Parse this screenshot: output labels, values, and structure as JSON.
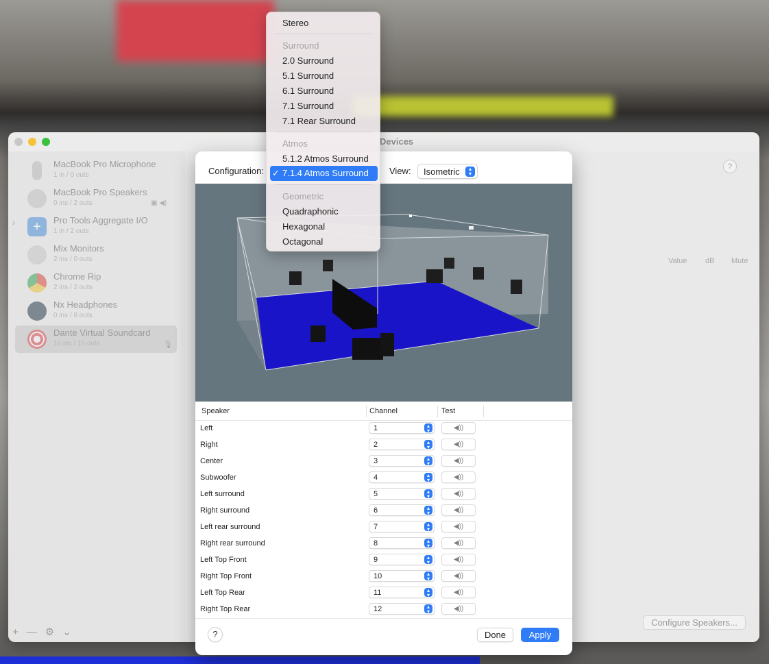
{
  "window": {
    "title": "Devices"
  },
  "sidebar": {
    "devices": [
      {
        "name": "MacBook Pro Microphone",
        "sub": "1 in / 0 outs",
        "icon": "microphone-icon"
      },
      {
        "name": "MacBook Pro Speakers",
        "sub": "0 ins / 2 outs",
        "icon": "speaker-icon"
      },
      {
        "name": "Pro Tools Aggregate I/O",
        "sub": "1 in / 2 outs",
        "icon": "aggregate-device-icon"
      },
      {
        "name": "Mix Monitors",
        "sub": "2 ins / 0 outs",
        "icon": "microphone-icon"
      },
      {
        "name": "Chrome Rip",
        "sub": "2 ins / 2 outs",
        "icon": "chrome-icon"
      },
      {
        "name": "Nx Headphones",
        "sub": "0 ins / 8 outs",
        "icon": "waves-icon"
      },
      {
        "name": "Dante Virtual Soundcard",
        "sub": "16 ins / 16 outs",
        "icon": "dante-icon"
      }
    ],
    "footer": {
      "add": "+",
      "remove": "—",
      "gear": "⚙",
      "chevron": "⌄"
    }
  },
  "main": {
    "columns": {
      "value": "Value",
      "db": "dB",
      "mute": "Mute"
    },
    "configure_button": "Configure Speakers..."
  },
  "sheet": {
    "config_label": "Configuration:",
    "view_label": "View:",
    "view_value": "Isometric",
    "table": {
      "headers": {
        "speaker": "Speaker",
        "channel": "Channel",
        "test": "Test"
      },
      "rows": [
        {
          "speaker": "Left",
          "channel": "1"
        },
        {
          "speaker": "Right",
          "channel": "2"
        },
        {
          "speaker": "Center",
          "channel": "3"
        },
        {
          "speaker": "Subwoofer",
          "channel": "4"
        },
        {
          "speaker": "Left surround",
          "channel": "5"
        },
        {
          "speaker": "Right surround",
          "channel": "6"
        },
        {
          "speaker": "Left rear surround",
          "channel": "7"
        },
        {
          "speaker": "Right rear surround",
          "channel": "8"
        },
        {
          "speaker": "Left Top Front",
          "channel": "9"
        },
        {
          "speaker": "Right Top Front",
          "channel": "10"
        },
        {
          "speaker": "Left Top Rear",
          "channel": "11"
        },
        {
          "speaker": "Right Top Rear",
          "channel": "12"
        }
      ],
      "test_glyph": "◀))"
    },
    "help": "?",
    "done": "Done",
    "apply": "Apply"
  },
  "menu": {
    "stereo": "Stereo",
    "surround_header": "Surround",
    "surround": [
      "2.0 Surround",
      "5.1 Surround",
      "6.1 Surround",
      "7.1 Surround",
      "7.1 Rear Surround"
    ],
    "atmos_header": "Atmos",
    "atmos_512": "5.1.2 Atmos Surround",
    "atmos_714": "7.1.4 Atmos Surround",
    "check": "✓",
    "geometric_header": "Geometric",
    "geometric": [
      "Quadraphonic",
      "Hexagonal",
      "Octagonal"
    ]
  },
  "colors": {
    "accent": "#2f7cf6",
    "floor": "#1a14c8",
    "viewport_bg": "#66767f"
  }
}
